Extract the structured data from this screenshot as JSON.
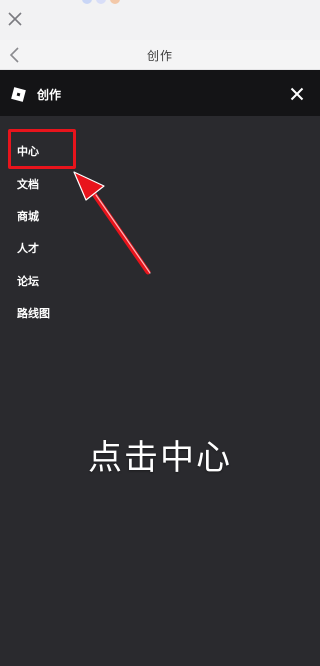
{
  "status": {
    "close_icon": "close-x-icon"
  },
  "navbar": {
    "back_icon": "chevron-left-icon",
    "title": "创作"
  },
  "drawer": {
    "logo_icon": "roblox-logo-icon",
    "title": "创作",
    "close_icon": "close-icon",
    "items": [
      {
        "label": "中心"
      },
      {
        "label": "文档"
      },
      {
        "label": "商城"
      },
      {
        "label": "人才"
      },
      {
        "label": "论坛"
      },
      {
        "label": "路线图"
      }
    ]
  },
  "annotation": {
    "caption": "点击中心",
    "highlight_color": "#e8141c"
  }
}
